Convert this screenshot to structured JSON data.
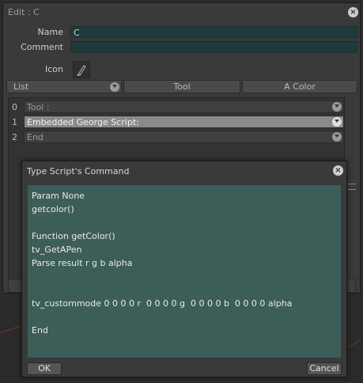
{
  "edit_window": {
    "title": "Edit : C",
    "name_label": "Name",
    "name_value": "C",
    "comment_label": "Comment",
    "comment_value": "",
    "icon_label": "Icon",
    "header": {
      "list_label": "List",
      "tool_label": "Tool",
      "color_label": "A Color"
    },
    "rows": [
      {
        "index": "0",
        "text": "Tool :"
      },
      {
        "index": "1",
        "text": "Embedded George Script:"
      },
      {
        "index": "2",
        "text": "End"
      }
    ]
  },
  "script_dialog": {
    "title": "Type Script's Command",
    "code": "Param None\ngetcolor()\n\nFunction getColor()\ntv_GetAPen\nParse result r g b alpha\n\n\ntv_custommode 0 0 0 0 r  0 0 0 0 g  0 0 0 0 b  0 0 0 0 alpha\n\nEnd",
    "ok_label": "OK",
    "cancel_label": "Cancel"
  },
  "colors": {
    "code_bg": "#3d5d59",
    "input_bg": "#1e3a3a",
    "selected_row": "#8a8a8a"
  }
}
